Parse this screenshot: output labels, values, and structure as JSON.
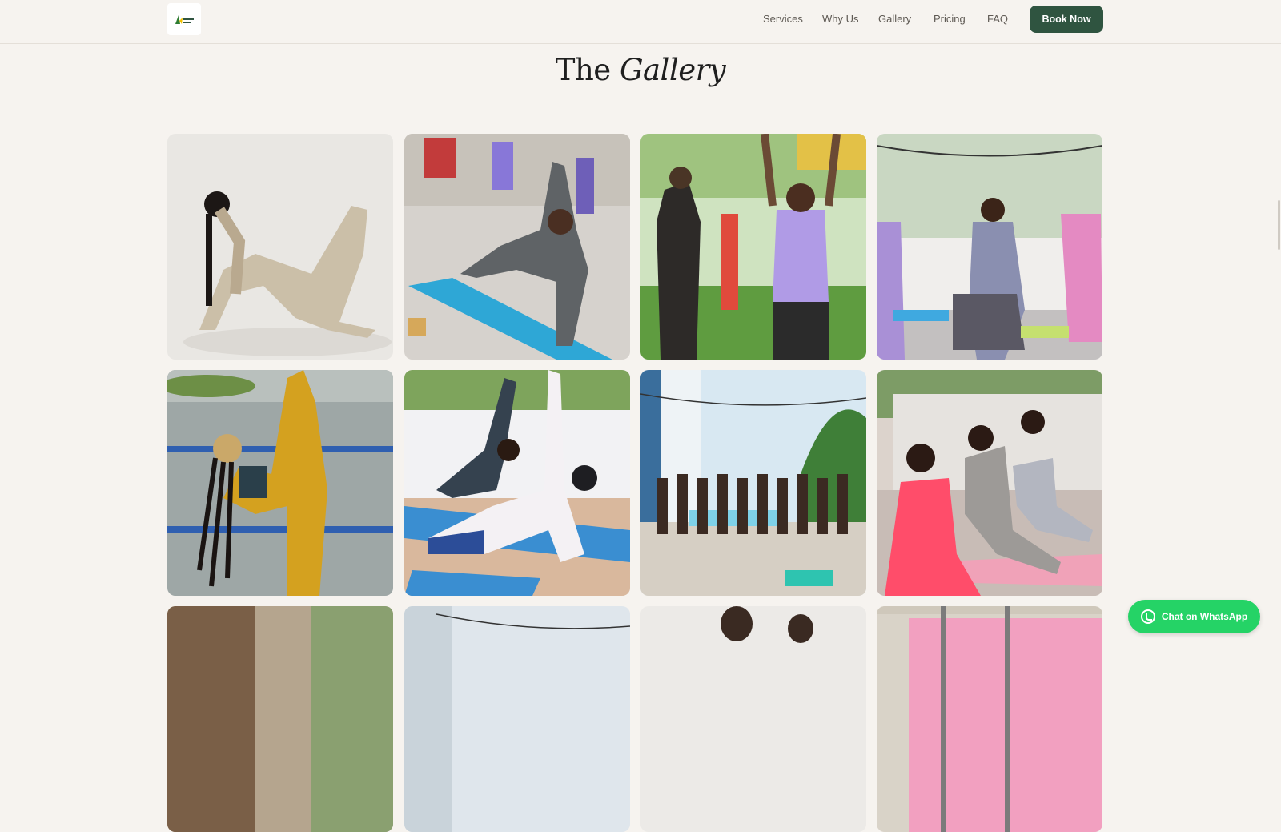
{
  "nav": {
    "items": [
      {
        "label": "Services"
      },
      {
        "label": "Why Us"
      },
      {
        "label": "Gallery"
      },
      {
        "label": "Pricing"
      },
      {
        "label": "FAQ"
      }
    ],
    "book_label": "Book Now"
  },
  "gallery": {
    "title_plain": "The",
    "title_italic": "Gallery",
    "photos": [
      {
        "description_icon": "photo-solo-bow-pose"
      },
      {
        "description_icon": "photo-man-side-angle"
      },
      {
        "description_icon": "photo-group-arms-raised-lawn"
      },
      {
        "description_icon": "photo-group-tree-pose-terrace"
      },
      {
        "description_icon": "photo-standing-split-railing"
      },
      {
        "description_icon": "photo-side-plank-duo"
      },
      {
        "description_icon": "photo-large-group-poolside"
      },
      {
        "description_icon": "photo-warrior-pose-group"
      },
      {
        "description_icon": "photo-row3-1"
      },
      {
        "description_icon": "photo-row3-2"
      },
      {
        "description_icon": "photo-row3-3"
      },
      {
        "description_icon": "photo-row3-4"
      }
    ]
  },
  "whatsapp": {
    "label": "Chat on WhatsApp"
  },
  "colors": {
    "background": "#f6f3ef",
    "brand": "#2f5440",
    "whatsapp": "#25d366"
  }
}
